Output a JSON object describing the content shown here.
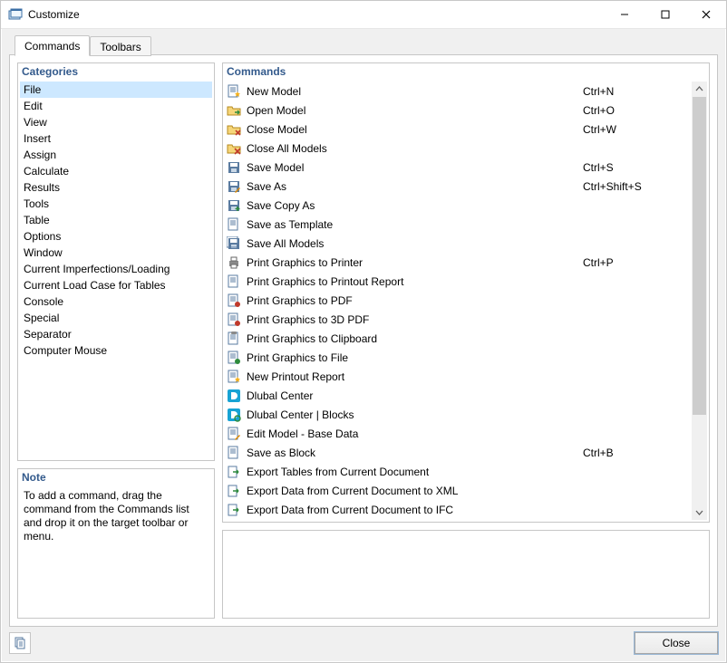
{
  "window": {
    "title": "Customize"
  },
  "tabs": {
    "commands": "Commands",
    "toolbars": "Toolbars"
  },
  "groups": {
    "categories_title": "Categories",
    "commands_title": "Commands",
    "note_title": "Note"
  },
  "categories": [
    "File",
    "Edit",
    "View",
    "Insert",
    "Assign",
    "Calculate",
    "Results",
    "Tools",
    "Table",
    "Options",
    "Window",
    "Current Imperfections/Loading",
    "Current Load Case for Tables",
    "Console",
    "Special",
    "Separator",
    "Computer Mouse"
  ],
  "selected_category_index": 0,
  "commands": [
    {
      "icon": "new-model-icon",
      "label": "New Model",
      "shortcut": "Ctrl+N"
    },
    {
      "icon": "open-model-icon",
      "label": "Open Model",
      "shortcut": "Ctrl+O"
    },
    {
      "icon": "close-model-icon",
      "label": "Close Model",
      "shortcut": "Ctrl+W"
    },
    {
      "icon": "close-all-icon",
      "label": "Close All Models",
      "shortcut": ""
    },
    {
      "icon": "save-icon",
      "label": "Save Model",
      "shortcut": "Ctrl+S"
    },
    {
      "icon": "save-as-icon",
      "label": "Save As",
      "shortcut": "Ctrl+Shift+S"
    },
    {
      "icon": "save-copy-icon",
      "label": "Save Copy As",
      "shortcut": ""
    },
    {
      "icon": "save-template-icon",
      "label": "Save as Template",
      "shortcut": ""
    },
    {
      "icon": "save-all-icon",
      "label": "Save All Models",
      "shortcut": ""
    },
    {
      "icon": "print-icon",
      "label": "Print Graphics to Printer",
      "shortcut": "Ctrl+P"
    },
    {
      "icon": "print-report-icon",
      "label": "Print Graphics to Printout Report",
      "shortcut": ""
    },
    {
      "icon": "print-pdf-icon",
      "label": "Print Graphics to PDF",
      "shortcut": ""
    },
    {
      "icon": "print-3dpdf-icon",
      "label": "Print Graphics to 3D PDF",
      "shortcut": ""
    },
    {
      "icon": "print-clipboard-icon",
      "label": "Print Graphics to Clipboard",
      "shortcut": ""
    },
    {
      "icon": "print-file-icon",
      "label": "Print Graphics to File",
      "shortcut": ""
    },
    {
      "icon": "new-printout-icon",
      "label": "New Printout Report",
      "shortcut": ""
    },
    {
      "icon": "dlubal-center-icon",
      "label": "Dlubal Center",
      "shortcut": ""
    },
    {
      "icon": "dlubal-blocks-icon",
      "label": "Dlubal Center | Blocks",
      "shortcut": ""
    },
    {
      "icon": "edit-basedata-icon",
      "label": "Edit Model - Base Data",
      "shortcut": ""
    },
    {
      "icon": "save-block-icon",
      "label": "Save as Block",
      "shortcut": "Ctrl+B"
    },
    {
      "icon": "export-tables-icon",
      "label": "Export Tables from Current Document",
      "shortcut": ""
    },
    {
      "icon": "export-xml-icon",
      "label": "Export Data from Current Document to XML",
      "shortcut": ""
    },
    {
      "icon": "export-ifc-icon",
      "label": "Export Data from Current Document to IFC",
      "shortcut": ""
    }
  ],
  "note_text": "To add a command, drag the command from the Commands list and drop it on the target toolbar or menu.",
  "footer": {
    "close_label": "Close"
  }
}
